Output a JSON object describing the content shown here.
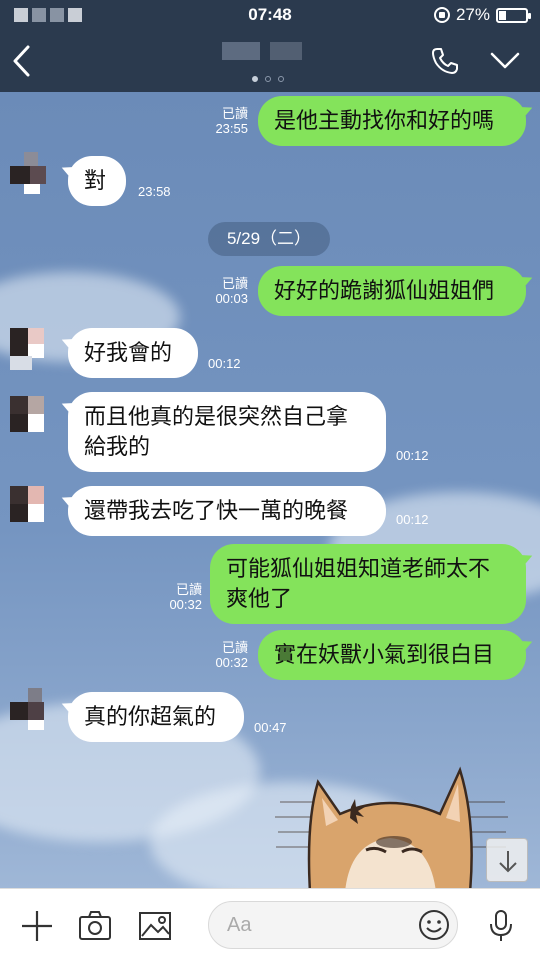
{
  "status_bar": {
    "time": "07:48",
    "battery": "27%",
    "battery_level": 0.27
  },
  "messages": [
    {
      "dir": "out",
      "text": "是他主動找你和好的嗎",
      "read": "已讀",
      "time": "23:55"
    },
    {
      "dir": "in",
      "text": "對",
      "time": "23:58"
    },
    {
      "dir": "date",
      "text": "5/29（二）"
    },
    {
      "dir": "out",
      "text": "好好的跪謝狐仙姐姐們",
      "read": "已讀",
      "time": "00:03"
    },
    {
      "dir": "in",
      "text": "好我會的",
      "time": "00:12"
    },
    {
      "dir": "in",
      "line1": "而且他真的是很突然自己拿",
      "line2": "給我的",
      "time": "00:12"
    },
    {
      "dir": "in",
      "text": "還帶我去吃了快一萬的晚餐",
      "time": "00:12"
    },
    {
      "dir": "out",
      "line1": "可能狐仙姐姐知道老師太不",
      "line2": "爽他了",
      "read": "已讀",
      "time": "00:32"
    },
    {
      "dir": "out",
      "text": "實在妖獸小氣到很白目",
      "read": "已讀",
      "time": "00:32"
    },
    {
      "dir": "in",
      "text": "真的你超氣的",
      "time": "00:47"
    }
  ],
  "input": {
    "placeholder": "Aa"
  },
  "colors": {
    "header": "#2b3a4e",
    "outgoing_bubble": "#84e35b",
    "incoming_bubble": "#ffffff"
  }
}
